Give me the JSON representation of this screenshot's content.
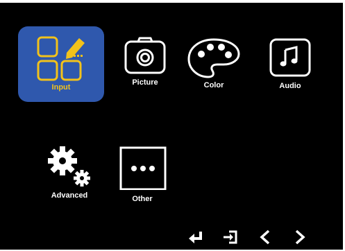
{
  "menu": {
    "items": [
      {
        "id": "input",
        "label": "Input",
        "icon": "input-edit-icon",
        "selected": true
      },
      {
        "id": "picture",
        "label": "Picture",
        "icon": "camera-icon",
        "selected": false
      },
      {
        "id": "color",
        "label": "Color",
        "icon": "palette-icon",
        "selected": false
      },
      {
        "id": "audio",
        "label": "Audio",
        "icon": "music-note-icon",
        "selected": false
      },
      {
        "id": "advanced",
        "label": "Advanced",
        "icon": "gears-icon",
        "selected": false
      },
      {
        "id": "other",
        "label": "Other",
        "icon": "more-icon",
        "selected": false
      }
    ]
  },
  "nav": {
    "buttons": [
      {
        "id": "enter",
        "icon": "enter-icon"
      },
      {
        "id": "exit",
        "icon": "exit-icon"
      },
      {
        "id": "left",
        "icon": "chevron-left-icon"
      },
      {
        "id": "right",
        "icon": "chevron-right-icon"
      }
    ]
  },
  "colors": {
    "background": "#000000",
    "selected_tile": "#2f58ad",
    "selected_accent": "#f2c21b",
    "foreground": "#ffffff"
  }
}
